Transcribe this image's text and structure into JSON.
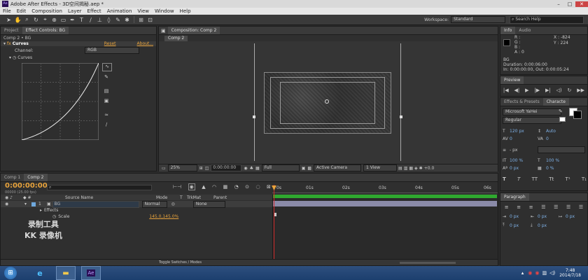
{
  "window": {
    "title": "Adobe After Effects - 3D空间揭秘.aep *",
    "app_icon_text": "Ae"
  },
  "menu": [
    "File",
    "Edit",
    "Composition",
    "Layer",
    "Effect",
    "Animation",
    "View",
    "Window",
    "Help"
  ],
  "toolbar": {
    "workspace_label": "Workspace:",
    "workspace_value": "Standard",
    "search_placeholder": "Search Help"
  },
  "project_panel": {
    "tabs": [
      "Project",
      "Effect Controls: BG"
    ],
    "breadcrumb": "Comp 2 • BG",
    "effect_name": "Curves",
    "reset_label": "Reset",
    "about_label": "About...",
    "channel_label": "Channel:",
    "channel_value": "RGB",
    "curves_label": "Curves"
  },
  "comp_panel": {
    "tab_label": "Composition: Comp 2",
    "sub_tab": "Comp 2",
    "footer": {
      "zoom": "25%",
      "time": "0:00:00:00",
      "quality": "Full",
      "camera": "Active Camera",
      "views": "1 View",
      "exposure": "+0.0"
    }
  },
  "info_panel": {
    "tabs": [
      "Info",
      "Audio"
    ],
    "r_label": "R :",
    "g_label": "G :",
    "b_label": "B :",
    "a_label": "A : 0",
    "x_val": "X : -824",
    "y_val": "Y : 224",
    "layer_name": "BG",
    "duration": "Duration: 0:00:06:00",
    "in_out": "In: 0:00:00:00, Out: 0:00:05:24"
  },
  "preview_panel": {
    "tab": "Preview"
  },
  "character_panel": {
    "tabs": [
      "Effects & Presets",
      "Characte"
    ],
    "font": "Microsoft YaHei",
    "style": "Regular",
    "size": "120 px",
    "leading": "Auto",
    "kerning": "0",
    "tracking": "0",
    "stroke": "- px",
    "v_scale": "100 %",
    "h_scale": "100 %",
    "baseline": "0 px",
    "tsume": "0 %"
  },
  "timeline": {
    "tabs": [
      "Comp 1",
      "Comp 2"
    ],
    "timecode": "0:00:00:00",
    "fps": "00000 (25.00 fps)",
    "columns": {
      "source_name": "Source Name",
      "mode": "Mode",
      "trkmat": "TrkMat",
      "parent": "Parent"
    },
    "layer": {
      "number": "1",
      "name": "BG",
      "mode": "Normal",
      "parent": "None"
    },
    "effects_label": "Effects",
    "scale_label": "Scale",
    "scale_value": "145.0,145.0%",
    "ruler": [
      "0s",
      "01s",
      "02s",
      "03s",
      "04s",
      "05s",
      "06s"
    ],
    "toggle_label": "Toggle Switches / Modes",
    "watermark_line1": "录制工具",
    "watermark_line2": "KK 录像机"
  },
  "paragraph_panel": {
    "tab": "Paragraph",
    "fields": [
      "0 px",
      "0 px",
      "0 px",
      "0 px",
      "0 px"
    ]
  },
  "taskbar": {
    "clock_time": "7:48",
    "clock_date": "2014/7/18",
    "ae_text": "Ae"
  },
  "colors": {
    "accent_orange": "#e8a33c",
    "timeline_green": "#2fa82f",
    "playhead_red": "#d12a2a",
    "taskbar_blue": "#1c3f6e"
  }
}
